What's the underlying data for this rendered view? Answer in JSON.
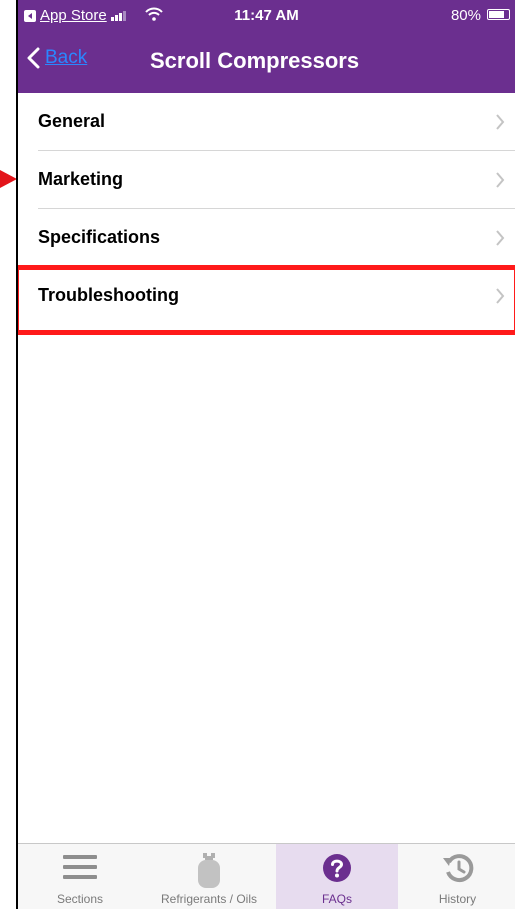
{
  "status_bar": {
    "back_app": "App Store",
    "time": "11:47 AM",
    "battery": "80%",
    "battery_level": 0.8
  },
  "nav": {
    "back_label": "Back",
    "title": "Scroll Compressors"
  },
  "list": {
    "items": [
      {
        "label": "General"
      },
      {
        "label": "Marketing"
      },
      {
        "label": "Specifications"
      },
      {
        "label": "Troubleshooting"
      }
    ]
  },
  "tabs": [
    {
      "label": "Sections",
      "icon": "menu-lines-icon"
    },
    {
      "label": "Refrigerants / Oils",
      "icon": "gas-cylinder-icon"
    },
    {
      "label": "FAQs",
      "icon": "question-circle-icon",
      "active": true
    },
    {
      "label": "History",
      "icon": "history-clock-icon"
    }
  ],
  "colors": {
    "brand": "#6b2f8f",
    "link": "#2a87ff",
    "highlight": "#ff1a1a"
  }
}
